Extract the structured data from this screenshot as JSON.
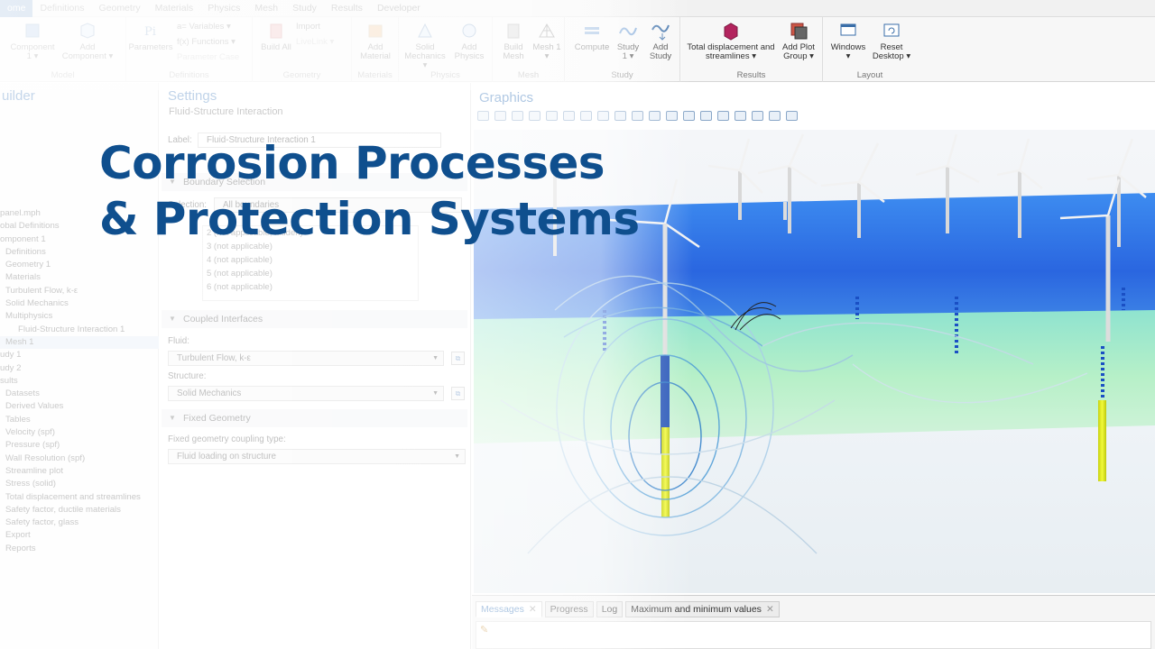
{
  "headline": {
    "line1": "Corrosion Processes",
    "line2": "& Protection Systems"
  },
  "menu": [
    "ome",
    "Definitions",
    "Geometry",
    "Materials",
    "Physics",
    "Mesh",
    "Study",
    "Results",
    "Developer"
  ],
  "ribbon": {
    "groups": {
      "model": "Model",
      "definitions": "Definitions",
      "geometry": "Geometry",
      "materials": "Materials",
      "physics": "Physics",
      "mesh": "Mesh",
      "study": "Study",
      "results": "Results",
      "layout": "Layout"
    },
    "buttons": {
      "component": "Component 1 ▾",
      "add_component": "Add Component ▾",
      "parameters": "Parameters",
      "variables": "a= Variables ▾",
      "functions": "f(x) Functions ▾",
      "param_case": "Parameter Case",
      "build_all": "Build All",
      "import": "Import",
      "levelset": "LiveLink ▾",
      "add_material": "Add Material",
      "solid_mechanics": "Solid Mechanics ▾",
      "add_physics": "Add Physics",
      "build_mesh": "Build Mesh",
      "mesh1": "Mesh 1 ▾",
      "compute": "Compute",
      "study1": "Study 1 ▾",
      "add_study": "Add Study",
      "total_disp": "Total displacement and streamlines ▾",
      "add_plot_group": "Add Plot Group ▾",
      "windows": "Windows ▾",
      "reset_desktop": "Reset Desktop ▾"
    }
  },
  "builder": {
    "title": "uilder",
    "tree": [
      "panel.mph",
      "obal Definitions",
      "omponent 1",
      "Definitions",
      "Geometry 1",
      "Materials",
      "Turbulent Flow, k-ε",
      "Solid Mechanics",
      "Multiphysics",
      "Fluid-Structure Interaction 1",
      "Mesh 1",
      "udy 1",
      "udy 2",
      "sults",
      "Datasets",
      "Derived Values",
      "Tables",
      "Velocity (spf)",
      "Pressure (spf)",
      "Wall Resolution (spf)",
      "Streamline plot",
      "Stress (solid)",
      "Total displacement and streamlines",
      "Safety factor, ductile materials",
      "Safety factor, glass",
      "Export",
      "Reports"
    ]
  },
  "settings": {
    "title": "Settings",
    "subtitle": "Fluid-Structure Interaction",
    "label_caption": "Label:",
    "label_value": "Fluid-Structure Interaction 1",
    "boundary_section": "Boundary Selection",
    "selection_caption": "Selection:",
    "selection_value": "All boundaries",
    "boundary_list": [
      "2 (not applicable, hidden)",
      "3 (not applicable)",
      "4 (not applicable)",
      "5 (not applicable)",
      "6 (not applicable)"
    ],
    "coupled_section": "Coupled Interfaces",
    "fluid_caption": "Fluid:",
    "fluid_value": "Turbulent Flow, k-ε",
    "structure_caption": "Structure:",
    "structure_value": "Solid Mechanics",
    "fixed_section": "Fixed Geometry",
    "fixed_caption": "Fixed geometry coupling type:",
    "fixed_value": "Fluid loading on structure"
  },
  "graphics": {
    "title": "Graphics"
  },
  "messages": {
    "tabs": [
      "Messages",
      "Progress",
      "Log",
      "Maximum and minimum values"
    ]
  },
  "colors": {
    "headline": "#0f4f8e",
    "accent": "#2f6fb6",
    "sea_surface": "#2c6fe6",
    "water_body": "#9fe8c8",
    "pile_highlight": "#e6f01a"
  }
}
